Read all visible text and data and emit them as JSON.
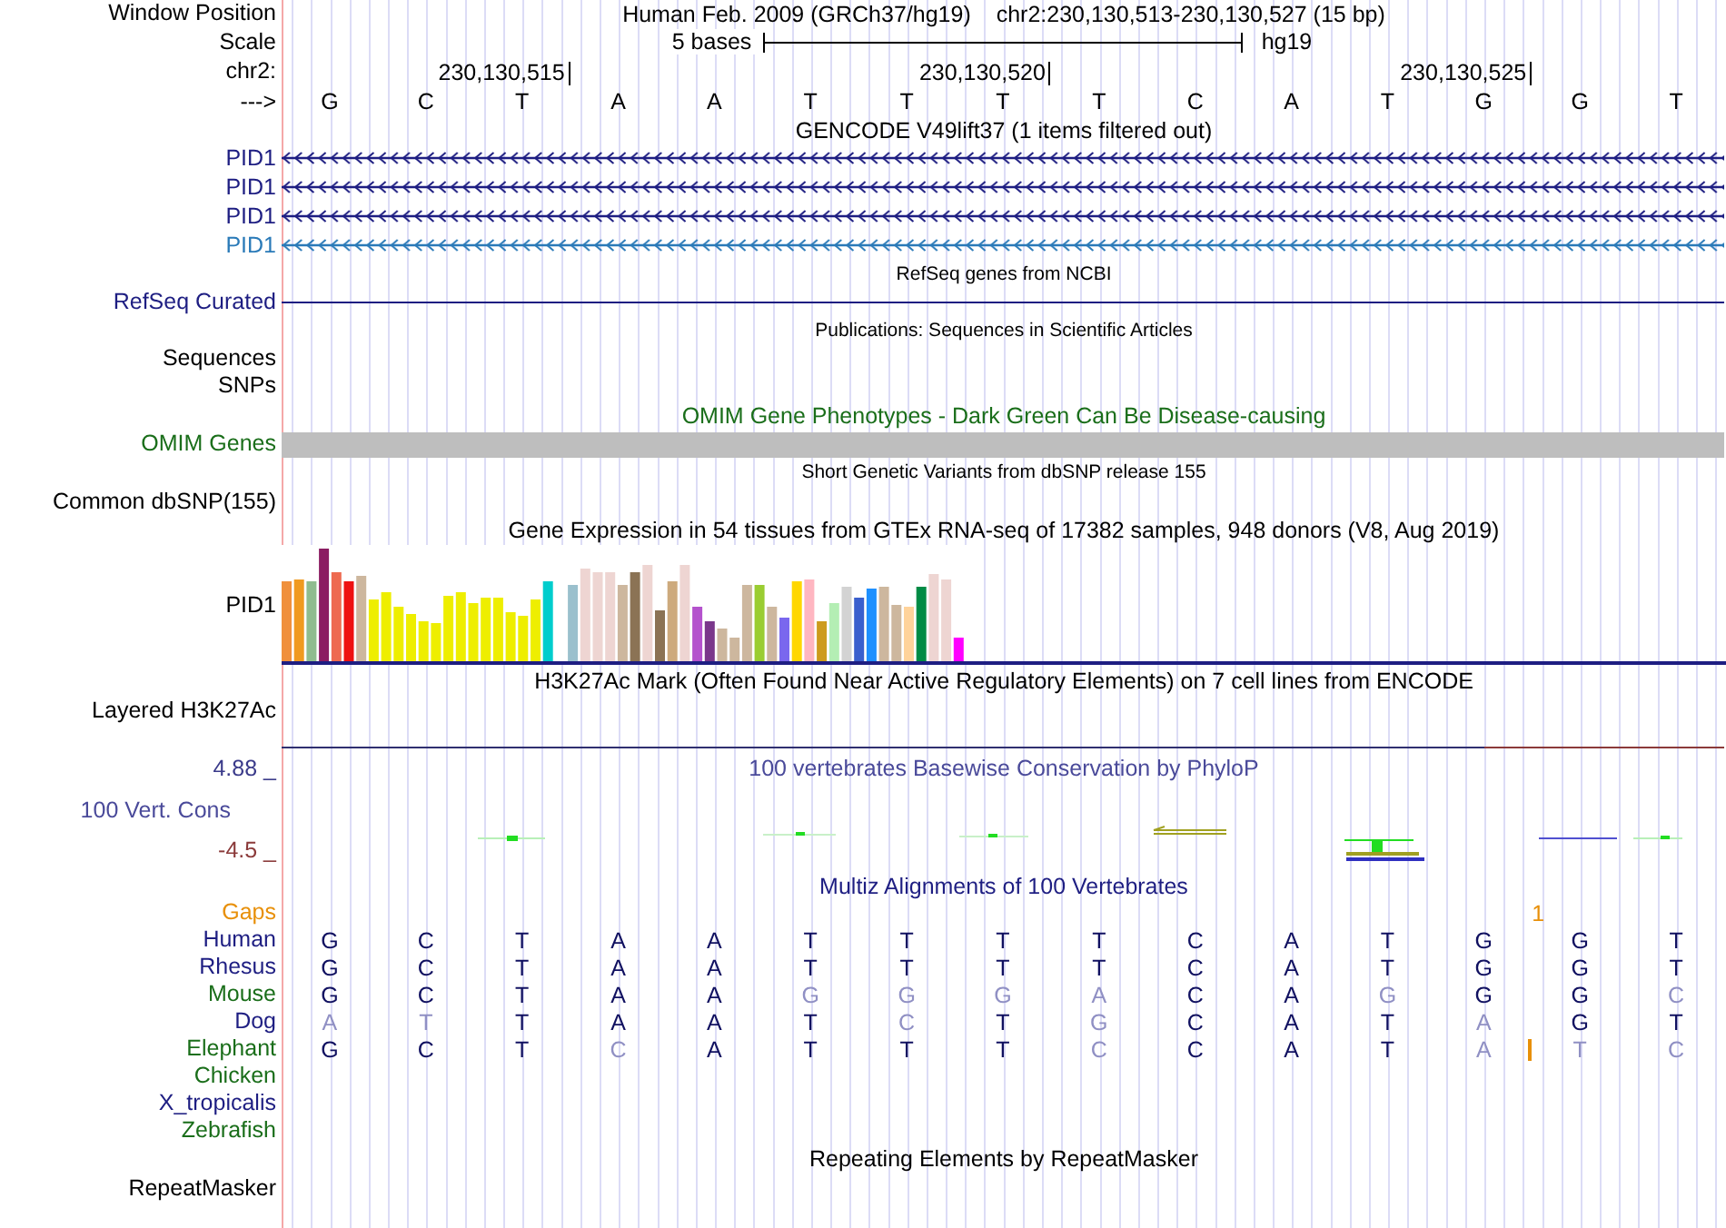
{
  "header": {
    "label": "Window Position",
    "assembly": "Human Feb. 2009 (GRCh37/hg19)",
    "position": "chr2:230,130,513-230,130,527 (15 bp)"
  },
  "scale": {
    "label": "Scale",
    "span": "5 bases",
    "db": "hg19"
  },
  "ruler": {
    "label": "chr2:",
    "ticks": [
      "230,130,515",
      "230,130,520",
      "230,130,525"
    ]
  },
  "sequence": {
    "label": "--->",
    "bases": [
      "G",
      "C",
      "T",
      "A",
      "A",
      "T",
      "T",
      "T",
      "T",
      "C",
      "A",
      "T",
      "G",
      "G",
      "T"
    ]
  },
  "gencode": {
    "title": "GENCODE V49lift37 (1 items filtered out)",
    "genes": [
      {
        "name": "PID1",
        "color": "#1e1e82"
      },
      {
        "name": "PID1",
        "color": "#1e1e82"
      },
      {
        "name": "PID1",
        "color": "#1e1e82"
      },
      {
        "name": "PID1",
        "color": "#2a7ab8"
      }
    ]
  },
  "refseq": {
    "title": "RefSeq genes from NCBI",
    "label": "RefSeq Curated"
  },
  "publications": {
    "title": "Publications: Sequences in Scientific Articles",
    "labels": [
      "Sequences",
      "SNPs"
    ]
  },
  "omim": {
    "title": "OMIM Gene Phenotypes - Dark Green Can Be Disease-causing",
    "label": "OMIM Genes"
  },
  "dbsnp": {
    "title": "Short Genetic Variants from dbSNP release 155",
    "label": "Common dbSNP(155)"
  },
  "gtex": {
    "title": "Gene Expression in 54 tissues from GTEx RNA-seq of 17382 samples, 948 donors (V8, Aug 2019)",
    "label": "PID1"
  },
  "h3k27ac": {
    "title": "H3K27Ac Mark (Often Found Near Active Regulatory Elements) on 7 cell lines from ENCODE",
    "label": "Layered H3K27Ac"
  },
  "phylop": {
    "title": "100 vertebrates Basewise Conservation by PhyloP",
    "max": "4.88 _",
    "label": "100 Vert. Cons",
    "min": "-4.5 _"
  },
  "multiz": {
    "title": "Multiz Alignments of 100 Vertebrates",
    "gaps_label": "Gaps",
    "gap_count": "1",
    "species": [
      {
        "name": "Human",
        "color": "#1e1e82",
        "bases": [
          {
            "base": "G",
            "differs": false
          },
          {
            "base": "C",
            "differs": false
          },
          {
            "base": "T",
            "differs": false
          },
          {
            "base": "A",
            "differs": false
          },
          {
            "base": "A",
            "differs": false
          },
          {
            "base": "T",
            "differs": false
          },
          {
            "base": "T",
            "differs": false
          },
          {
            "base": "T",
            "differs": false
          },
          {
            "base": "T",
            "differs": false
          },
          {
            "base": "C",
            "differs": false
          },
          {
            "base": "A",
            "differs": false
          },
          {
            "base": "T",
            "differs": false
          },
          {
            "base": "G",
            "differs": false
          },
          {
            "base": "G",
            "differs": false
          },
          {
            "base": "T",
            "differs": false
          }
        ]
      },
      {
        "name": "Rhesus",
        "color": "#1e1e82",
        "bases": [
          {
            "base": "G",
            "differs": false
          },
          {
            "base": "C",
            "differs": false
          },
          {
            "base": "T",
            "differs": false
          },
          {
            "base": "A",
            "differs": false
          },
          {
            "base": "A",
            "differs": false
          },
          {
            "base": "T",
            "differs": false
          },
          {
            "base": "T",
            "differs": false
          },
          {
            "base": "T",
            "differs": false
          },
          {
            "base": "T",
            "differs": false
          },
          {
            "base": "C",
            "differs": false
          },
          {
            "base": "A",
            "differs": false
          },
          {
            "base": "T",
            "differs": false
          },
          {
            "base": "G",
            "differs": false
          },
          {
            "base": "G",
            "differs": false
          },
          {
            "base": "T",
            "differs": false
          }
        ]
      },
      {
        "name": "Mouse",
        "color": "#1a6e1a",
        "bases": [
          {
            "base": "G",
            "differs": false
          },
          {
            "base": "C",
            "differs": false
          },
          {
            "base": "T",
            "differs": false
          },
          {
            "base": "A",
            "differs": false
          },
          {
            "base": "A",
            "differs": false
          },
          {
            "base": "G",
            "differs": true
          },
          {
            "base": "G",
            "differs": true
          },
          {
            "base": "G",
            "differs": true
          },
          {
            "base": "A",
            "differs": true
          },
          {
            "base": "C",
            "differs": false
          },
          {
            "base": "A",
            "differs": false
          },
          {
            "base": "G",
            "differs": true
          },
          {
            "base": "G",
            "differs": false
          },
          {
            "base": "G",
            "differs": false
          },
          {
            "base": "C",
            "differs": true
          }
        ]
      },
      {
        "name": "Dog",
        "color": "#1e1e82",
        "bases": [
          {
            "base": "A",
            "differs": true
          },
          {
            "base": "T",
            "differs": true
          },
          {
            "base": "T",
            "differs": false
          },
          {
            "base": "A",
            "differs": false
          },
          {
            "base": "A",
            "differs": false
          },
          {
            "base": "T",
            "differs": false
          },
          {
            "base": "C",
            "differs": true
          },
          {
            "base": "T",
            "differs": false
          },
          {
            "base": "G",
            "differs": true
          },
          {
            "base": "C",
            "differs": false
          },
          {
            "base": "A",
            "differs": false
          },
          {
            "base": "T",
            "differs": false
          },
          {
            "base": "A",
            "differs": true
          },
          {
            "base": "G",
            "differs": false
          },
          {
            "base": "T",
            "differs": false
          }
        ]
      },
      {
        "name": "Elephant",
        "color": "#1a6e1a",
        "bases": [
          {
            "base": "G",
            "differs": false
          },
          {
            "base": "C",
            "differs": false
          },
          {
            "base": "T",
            "differs": false
          },
          {
            "base": "C",
            "differs": true
          },
          {
            "base": "A",
            "differs": false
          },
          {
            "base": "T",
            "differs": false
          },
          {
            "base": "T",
            "differs": false
          },
          {
            "base": "T",
            "differs": false
          },
          {
            "base": "C",
            "differs": true
          },
          {
            "base": "C",
            "differs": false
          },
          {
            "base": "A",
            "differs": false
          },
          {
            "base": "T",
            "differs": false
          },
          {
            "base": "A",
            "differs": true,
            "insertion": true
          },
          {
            "base": "T",
            "differs": true
          },
          {
            "base": "C",
            "differs": true
          }
        ]
      },
      {
        "name": "Chicken",
        "color": "#1a6e1a"
      },
      {
        "name": "X_tropicalis",
        "color": "#1e1e82"
      },
      {
        "name": "Zebrafish",
        "color": "#1a6e1a"
      }
    ]
  },
  "repeatmasker": {
    "title": "Repeating Elements by RepeatMasker",
    "label": "RepeatMasker"
  }
}
